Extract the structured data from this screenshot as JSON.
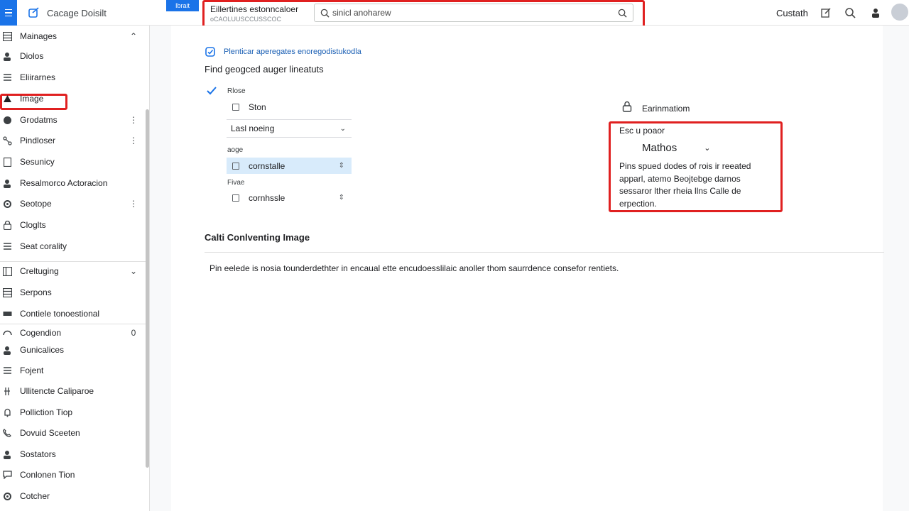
{
  "header": {
    "app_title": "Cacage Doisilt",
    "tag": "Ibrait",
    "toolbar_title": "Eillertines estonncaloer",
    "toolbar_subtitle": "oCAOLUUSCCUSSCOC",
    "search_value": "sinicl anoharew",
    "user_label": "Custath"
  },
  "sidebar": {
    "items": [
      {
        "label": "Mainages",
        "icon": "grid-icon",
        "trail": "expand_less"
      },
      {
        "label": "Diolos",
        "icon": "person-icon",
        "trail": ""
      },
      {
        "label": "Eliirarnes",
        "icon": "list-icon",
        "trail": ""
      },
      {
        "label": "Image",
        "icon": "triangle-icon",
        "trail": ""
      },
      {
        "label": "Grodatms",
        "icon": "circle-icon",
        "trail": "more"
      },
      {
        "label": "Pindloser",
        "icon": "nodes-icon",
        "trail": "more"
      },
      {
        "label": "Sesunicy",
        "icon": "doc-icon",
        "trail": ""
      },
      {
        "label": "Resalmorco Actoracion",
        "icon": "person-icon",
        "trail": ""
      },
      {
        "label": "Seotope",
        "icon": "gear-icon",
        "trail": "more"
      },
      {
        "label": "Cloglts",
        "icon": "lock-icon",
        "trail": ""
      },
      {
        "label": "Seat corality",
        "icon": "list-icon",
        "trail": ""
      },
      {
        "label": "Creltuging",
        "icon": "table-icon",
        "trail": "expand_more"
      },
      {
        "label": "Serpons",
        "icon": "grid-icon",
        "trail": ""
      },
      {
        "label": "Contiele tonoestional",
        "icon": "bar-icon",
        "trail": ""
      },
      {
        "label": "Cogendion",
        "icon": "arc-icon",
        "trail": "0"
      },
      {
        "label": "Gunicalices",
        "icon": "person-icon",
        "trail": ""
      },
      {
        "label": "Fojent",
        "icon": "list-icon",
        "trail": ""
      },
      {
        "label": "Ullitencte Caliparoe",
        "icon": "pin-icon",
        "trail": ""
      },
      {
        "label": "Polliction Tiop",
        "icon": "bell-icon",
        "trail": ""
      },
      {
        "label": "Dovuid Sceeten",
        "icon": "phone-icon",
        "trail": ""
      },
      {
        "label": "Sostators",
        "icon": "person-icon",
        "trail": ""
      },
      {
        "label": "Conlonen Tion",
        "icon": "chat-icon",
        "trail": ""
      },
      {
        "label": "Cotcher",
        "icon": "gear-icon",
        "trail": ""
      }
    ]
  },
  "main": {
    "info_line": "Plenticar aperegates enoregodistukodla",
    "section_title": "Find geogced auger lineatuts",
    "label_rlose": "Rlose",
    "row_ston": "Ston",
    "select_value": "Lasl noeing",
    "label_aoge": "aoge",
    "row_sel": "cornstalle",
    "label_fivae": "Fivae",
    "row_last": "cornhssle",
    "right_title": "Earinmatiom",
    "rp_label": "Esc u poaor",
    "rp_select": "Mathos",
    "rp_desc": "Pins spued dodes of rois ir reeated apparl, atemo Beojtebge darnos sessaror lther rheia llns Calle de erpection.",
    "section2_title": "Calti Conlventing Image",
    "section2_text": "Pin eelede is nosia tounderdethter in encaual ette encudoesslilaic anoller thom saurrdence consefor rentiets."
  }
}
